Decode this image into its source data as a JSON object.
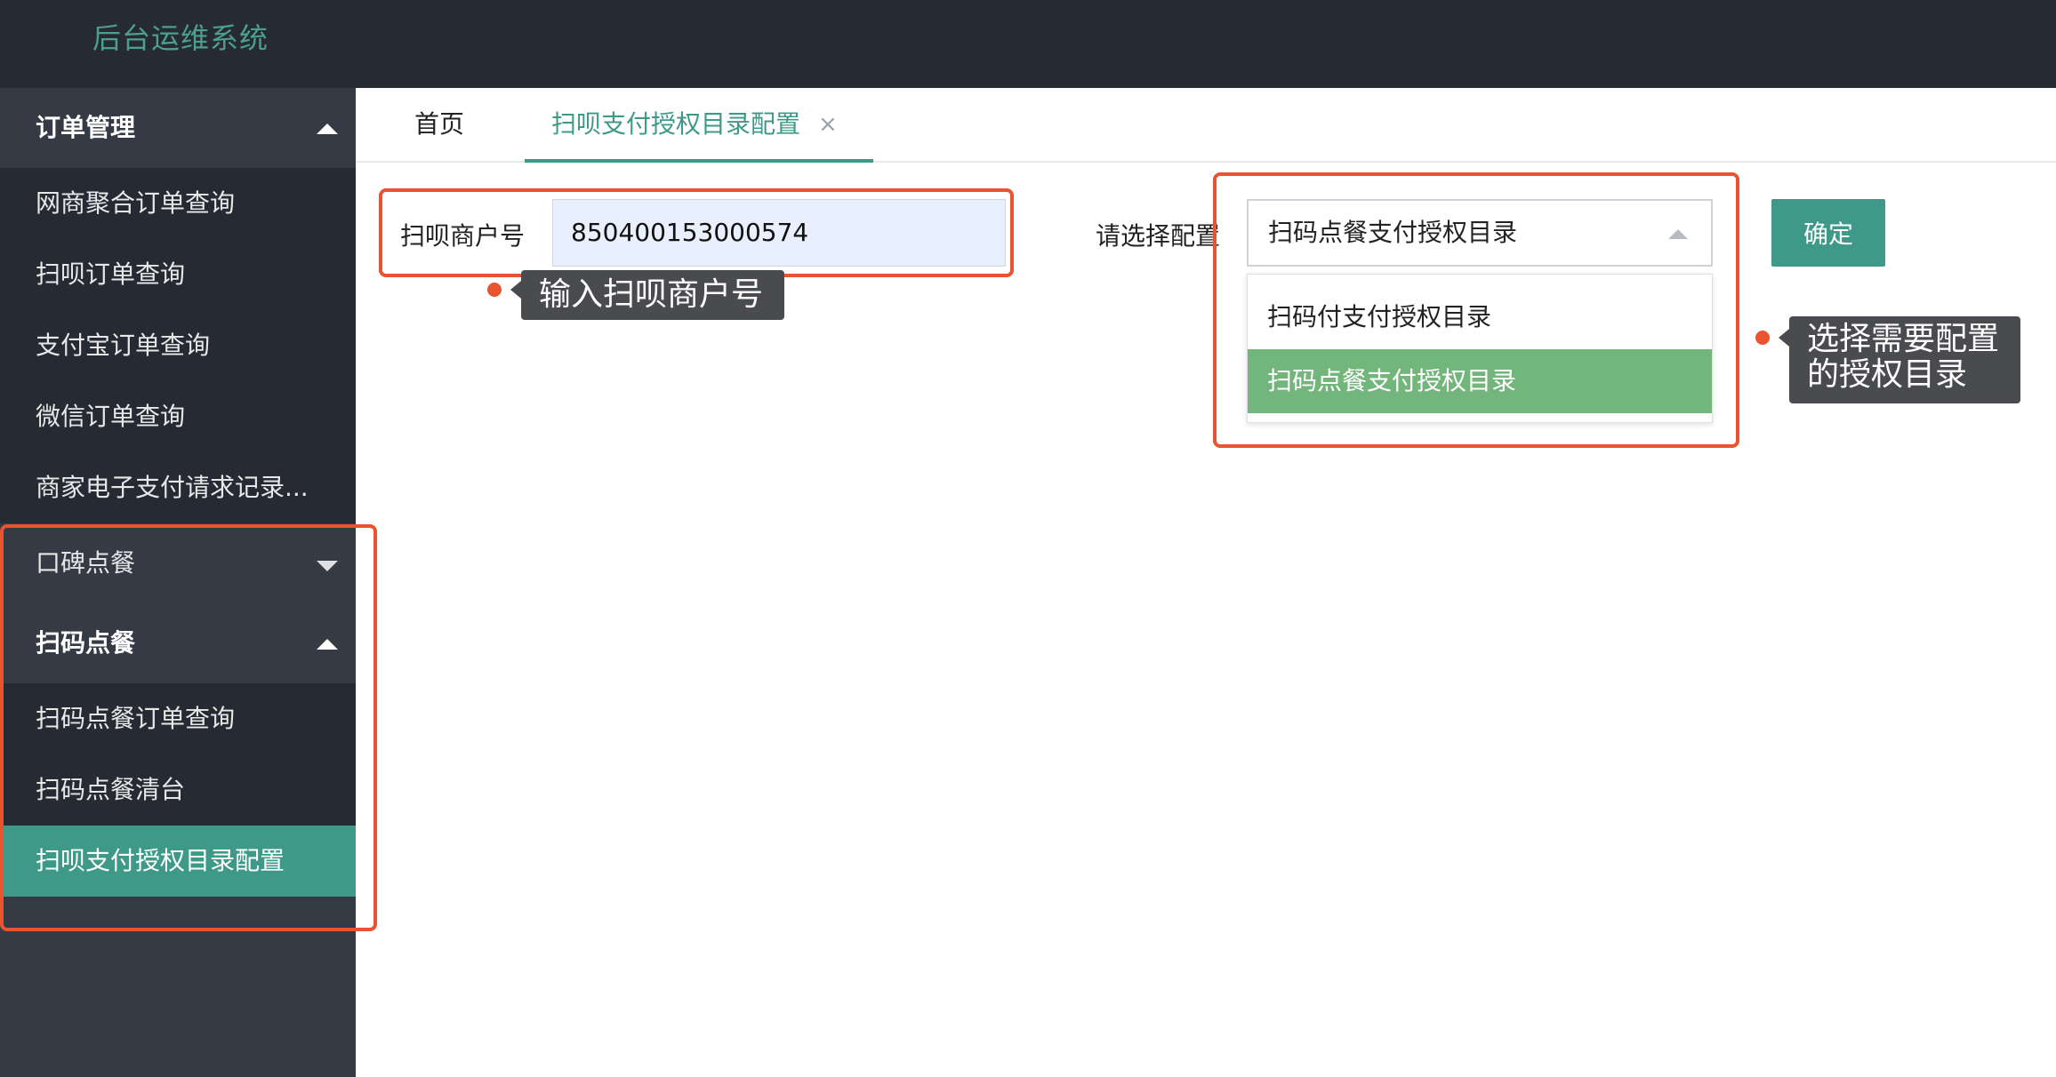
{
  "app": {
    "title": "后台运维系统"
  },
  "sidebar": {
    "group_order": {
      "label": "订单管理"
    },
    "order_items": [
      "网商聚合订单查询",
      "扫呗订单查询",
      "支付宝订单查询",
      "微信订单查询",
      "商家电子支付请求记录..."
    ],
    "group_koubei": {
      "label": "口碑点餐"
    },
    "group_scan": {
      "label": "扫码点餐"
    },
    "scan_items": [
      "扫码点餐订单查询",
      "扫码点餐清台",
      "扫呗支付授权目录配置"
    ],
    "active_item": "扫呗支付授权目录配置"
  },
  "tabs": {
    "home": "首页",
    "active": "扫呗支付授权目录配置",
    "close_glyph": "×"
  },
  "form": {
    "merchant_label": "扫呗商户号",
    "merchant_value": "850400153000574",
    "config_label": "请选择配置",
    "config_selected": "扫码点餐支付授权目录",
    "options": [
      "扫码付支付授权目录",
      "扫码点餐支付授权目录"
    ],
    "selected_option_index": 1,
    "confirm_label": "确定"
  },
  "annotations": {
    "tip_merchant": "输入扫呗商户号",
    "tip_config_line1": "选择需要配置",
    "tip_config_line2": "的授权目录",
    "highlight_color": "#e8542f"
  },
  "colors": {
    "accent": "#3f9988",
    "topbar": "#262a32",
    "sidebar": "#363a45",
    "selected_option": "#73b67c"
  }
}
